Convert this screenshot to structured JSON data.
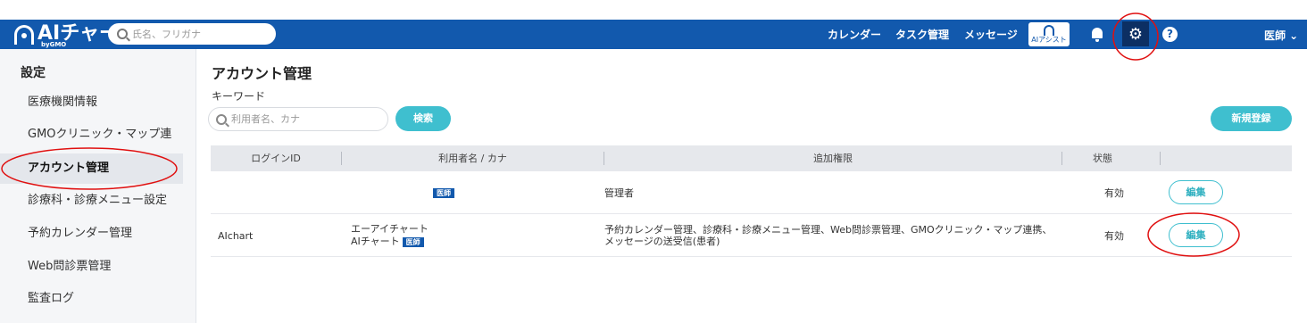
{
  "header": {
    "logo_text": "AIチャート",
    "logo_sub": "byGMO",
    "search_placeholder": "氏名、フリガナ",
    "nav": [
      "カレンダー",
      "タスク管理",
      "メッセージ"
    ],
    "assist_label": "AIアシスト",
    "user_label": "医師 ⌄",
    "help_glyph": "?"
  },
  "sidebar": {
    "title": "設定",
    "items": [
      {
        "label": "医療機関情報"
      },
      {
        "label": "GMOクリニック・マップ連携"
      },
      {
        "label": "アカウント管理"
      },
      {
        "label": "診療科・診療メニュー設定"
      },
      {
        "label": "予約カレンダー管理"
      },
      {
        "label": "Web問診票管理"
      },
      {
        "label": "監査ログ"
      }
    ],
    "active_index": 2
  },
  "main": {
    "title": "アカウント管理",
    "keyword_label": "キーワード",
    "keyword_placeholder": "利用者名、カナ",
    "search_button": "検索",
    "new_button": "新規登録",
    "columns": [
      "ログインID",
      "利用者名 / カナ",
      "追加権限",
      "状態"
    ],
    "rows": [
      {
        "login_id": "",
        "kana": "",
        "name": "",
        "role_badge": "医師",
        "permissions": "管理者",
        "status": "有効",
        "edit": "編集"
      },
      {
        "login_id": "AIchart",
        "kana": "エーアイチャート",
        "name": "AIチャート",
        "role_badge": "医師",
        "permissions": "予約カレンダー管理、診療科・診療メニュー管理、Web問診票管理、GMOクリニック・マップ連携、メッセージの送受信(患者)",
        "status": "有効",
        "edit": "編集"
      }
    ]
  },
  "colors": {
    "header": "#1259ad",
    "accent": "#3fbfcf",
    "annotation": "#e01010"
  },
  "icons": [
    "logo-icon",
    "search-icon",
    "ai-assist-icon",
    "bell-icon",
    "gear-icon",
    "help-icon"
  ]
}
